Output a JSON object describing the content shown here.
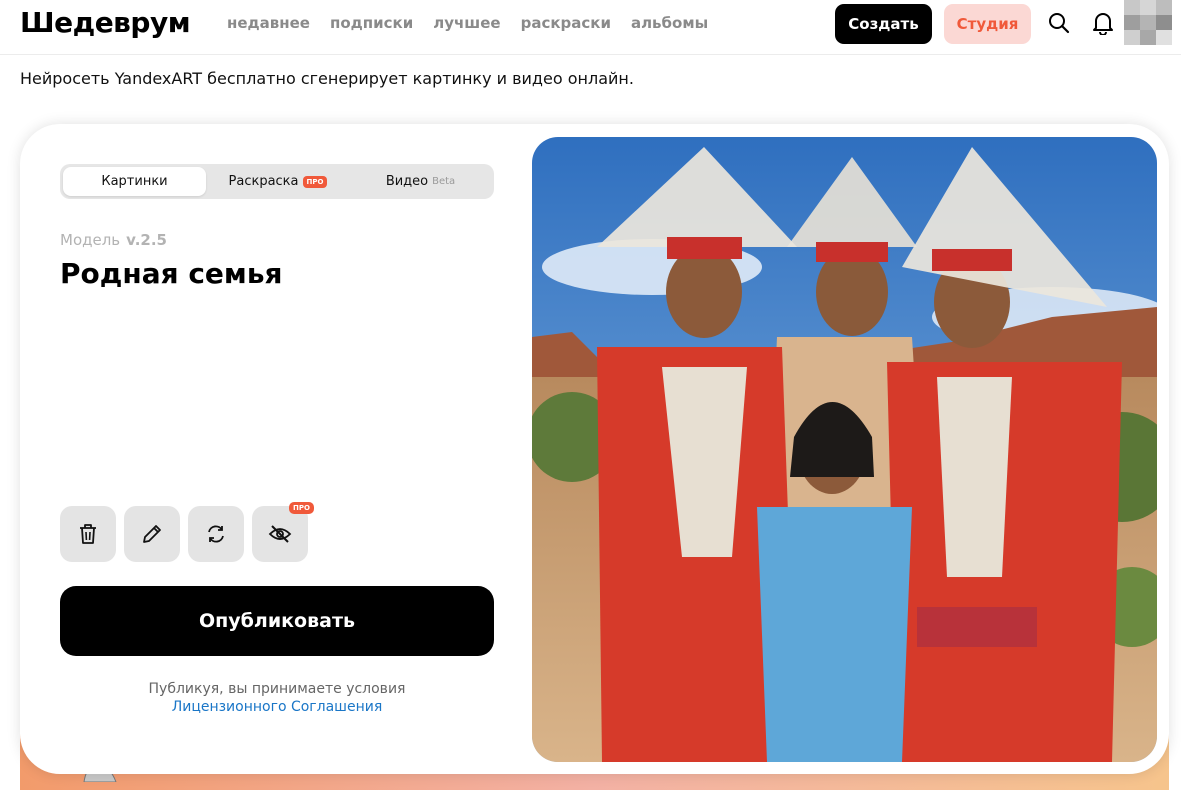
{
  "header": {
    "logo": "Шедеврум",
    "nav": [
      "недавнее",
      "подписки",
      "лучшее",
      "раскраски",
      "альбомы"
    ],
    "create_label": "Создать",
    "studio_label": "Студия"
  },
  "tagline": "Нейросеть YandexART бесплатно сгенерирует картинку и видео онлайн.",
  "tabs": {
    "pictures": "Картинки",
    "coloring": "Раскраска",
    "coloring_badge": "ПРО",
    "video": "Видео",
    "video_badge": "Beta"
  },
  "model": {
    "label": "Модель",
    "version": "v.2.5"
  },
  "title": "Родная семья",
  "tools": {
    "hide_badge": "ПРО"
  },
  "publish_label": "Опубликовать",
  "terms": {
    "text": "Публикуя, вы принимаете условия",
    "link": "Лицензионного Соглашения"
  },
  "colors": {
    "accent": "#f0593a",
    "studio_bg": "#fbd8d4",
    "link": "#1a76c7"
  },
  "icons": [
    "search-icon",
    "bell-icon",
    "trash-icon",
    "pencil-icon",
    "refresh-icon",
    "eye-off-icon"
  ]
}
